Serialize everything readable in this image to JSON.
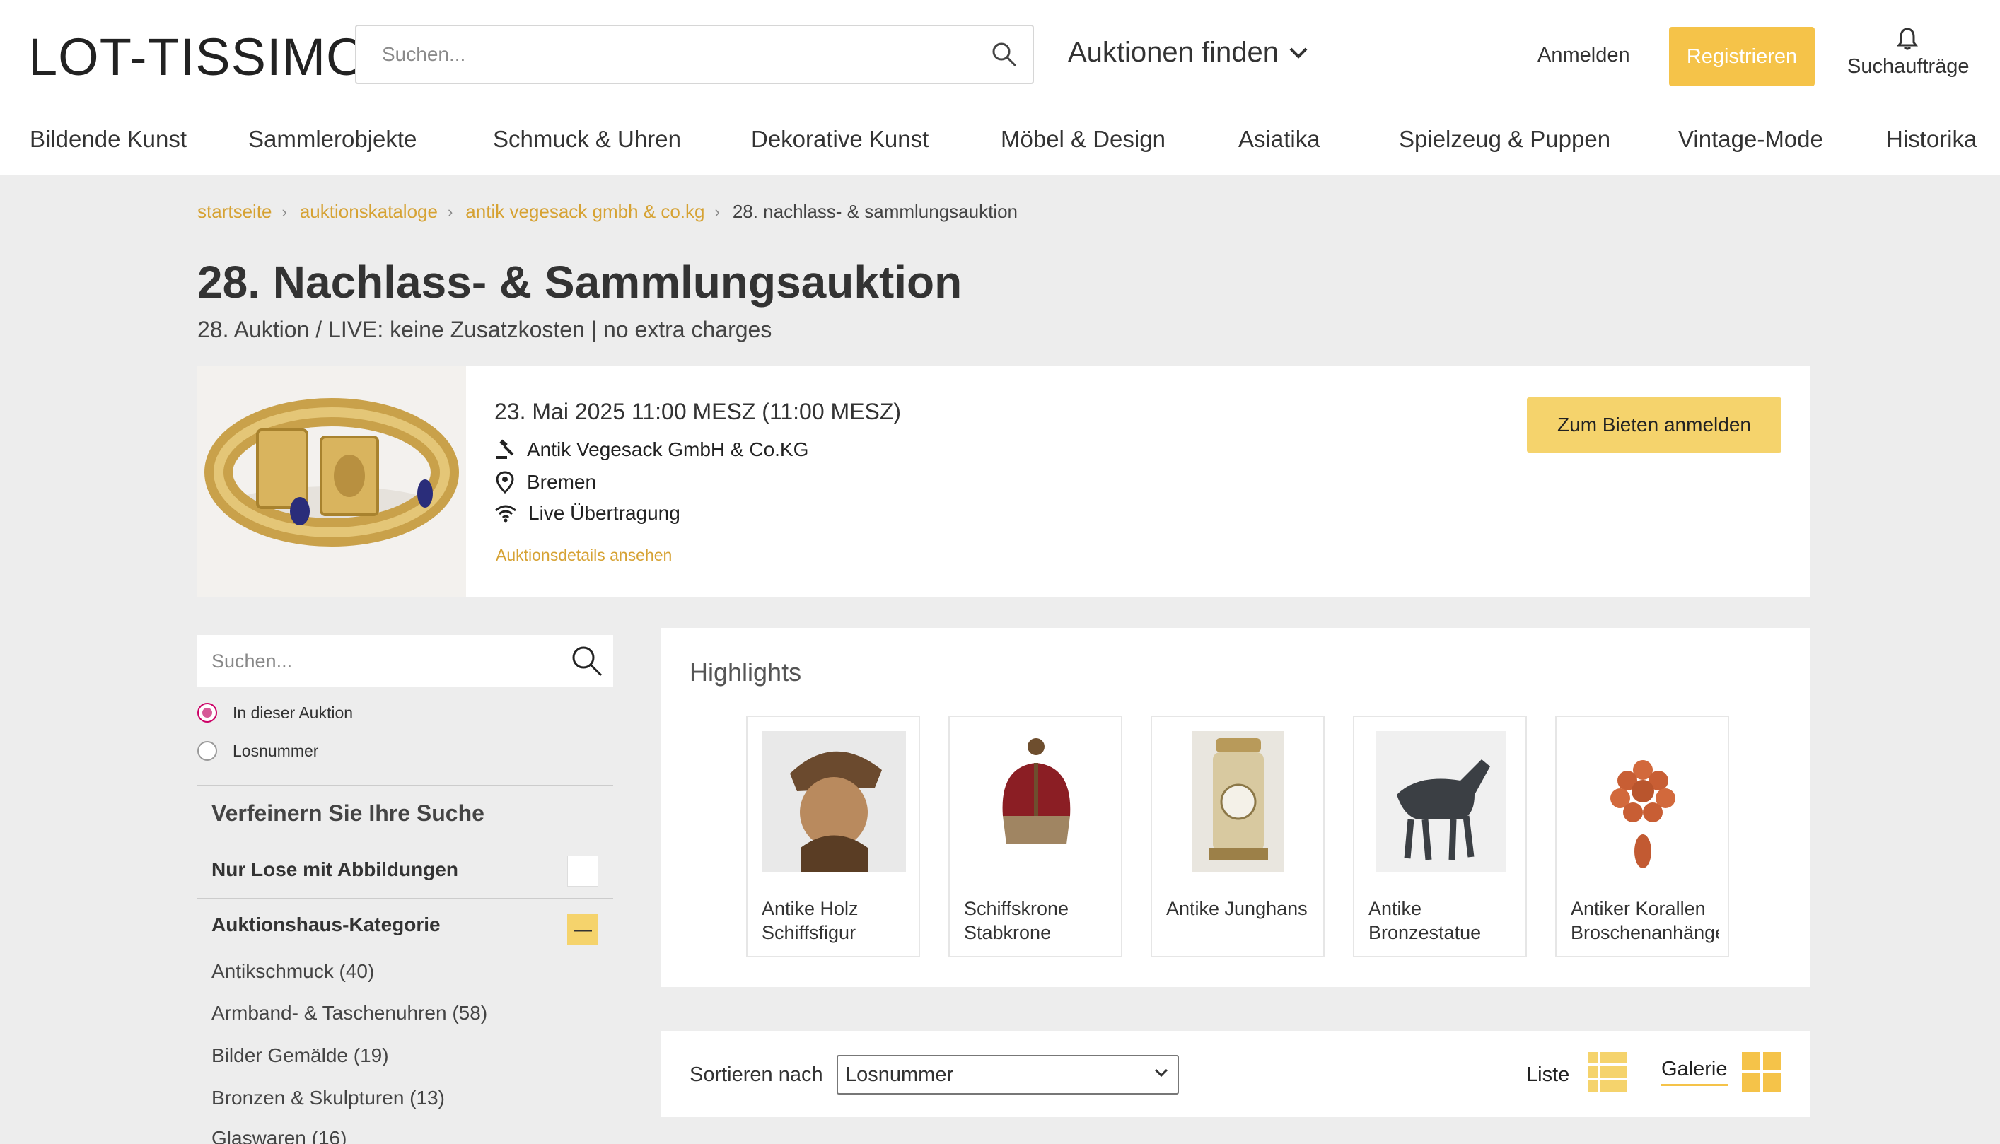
{
  "header": {
    "logo": "LOT-TISSIMO",
    "search_placeholder": "Suchen...",
    "find_auctions": "Auktionen finden",
    "login": "Anmelden",
    "register": "Registrieren",
    "alerts": "Suchaufträge"
  },
  "nav": {
    "items": [
      "Bildende Kunst",
      "Sammlerobjekte",
      "Schmuck & Uhren",
      "Dekorative Kunst",
      "Möbel & Design",
      "Asiatika",
      "Spielzeug & Puppen",
      "Vintage-Mode",
      "Historika"
    ]
  },
  "breadcrumb": [
    "startseite",
    "auktionskataloge",
    "antik vegesack gmbh & co.kg",
    "28. nachlass- & sammlungsauktion"
  ],
  "page": {
    "title": "28. Nachlass- & Sammlungsauktion",
    "subtitle": "28. Auktion / LIVE: keine Zusatzkosten | no extra charges"
  },
  "auction": {
    "date": "23. Mai 2025 11:00 MESZ (11:00 MESZ)",
    "house": "Antik Vegesack GmbH & Co.KG",
    "location": "Bremen",
    "broadcast": "Live Übertragung",
    "details_link": "Auktionsdetails ansehen",
    "bid_button": "Zum Bieten anmelden"
  },
  "sidebar": {
    "search_placeholder": "Suchen...",
    "radio_options": [
      {
        "label": "In dieser Auktion",
        "checked": true
      },
      {
        "label": "Losnummer",
        "checked": false
      }
    ],
    "refine_title": "Verfeinern Sie Ihre Suche",
    "only_images_label": "Nur Lose mit Abbildungen",
    "category_label": "Auktionshaus-Kategorie",
    "collapse_symbol": "—",
    "categories": [
      "Antikschmuck (40)",
      "Armband- & Taschenuhren (58)",
      "Bilder Gemälde (19)",
      "Bronzen & Skulpturen (13)",
      "Glaswaren (16)"
    ]
  },
  "highlights": {
    "title": "Highlights",
    "items": [
      {
        "caption": "Antike Holz Schiffsfigur"
      },
      {
        "caption": "Schiffskrone Stabkrone"
      },
      {
        "caption": "Antike Junghans"
      },
      {
        "caption": "Antike Bronzestatue"
      },
      {
        "caption": "Antiker Korallen Broschenanhänger"
      }
    ]
  },
  "sort": {
    "label": "Sortieren nach",
    "selected": "Losnummer",
    "view_list": "Liste",
    "view_gallery": "Galerie"
  },
  "colors": {
    "accent": "#f5c349",
    "link": "#d6a233",
    "radio": "#d65a98"
  }
}
